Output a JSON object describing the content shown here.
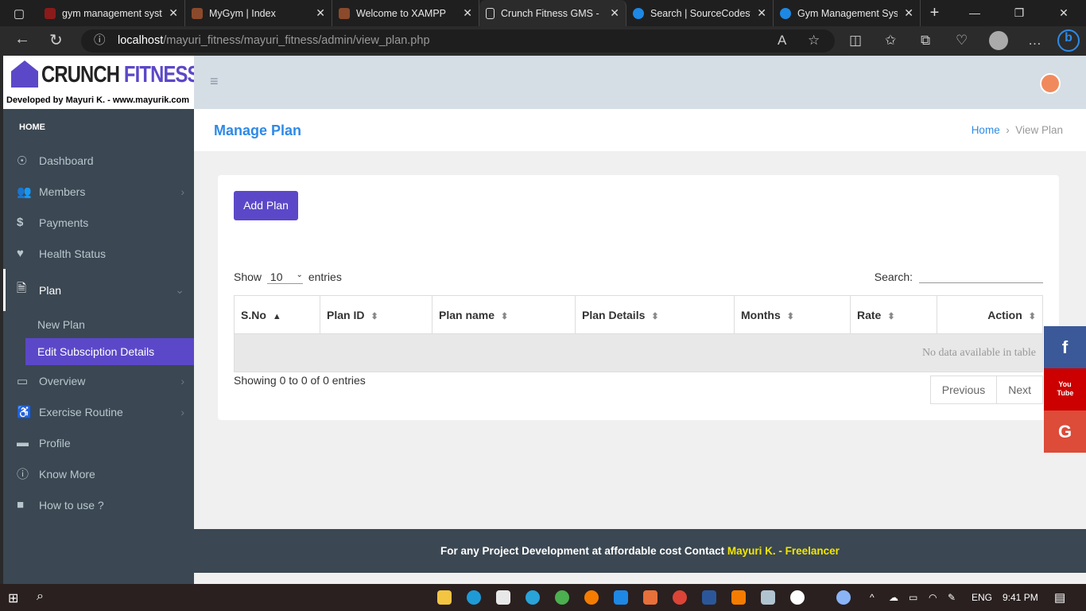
{
  "browser": {
    "tabs": [
      {
        "title": "gym management syst",
        "color": "#c4302b"
      },
      {
        "title": "MyGym | Index",
        "color": "#8b4a2b"
      },
      {
        "title": "Welcome to XAMPP",
        "color": "#8b4a2b"
      },
      {
        "title": "Crunch Fitness GMS - ",
        "color": "#ddd",
        "active": true
      },
      {
        "title": "Search | SourceCodest",
        "color": "#1e88e5"
      },
      {
        "title": "Gym Management Sys",
        "color": "#1e88e5"
      }
    ],
    "url_host": "localhost",
    "url_path": "/mayuri_fitness/mayuri_fitness/admin/view_plan.php"
  },
  "logo": {
    "brand_a": "CRUNCH",
    "brand_b": "FITNESS",
    "developer": "Developed by Mayuri K. - www.mayurik.com"
  },
  "sidebar": {
    "header": "HOME",
    "items": [
      {
        "label": "Dashboard",
        "icon": "☉"
      },
      {
        "label": "Members",
        "icon": "👥"
      },
      {
        "label": "Payments",
        "icon": "$"
      },
      {
        "label": "Health Status",
        "icon": "♥"
      },
      {
        "label": "Plan",
        "icon": "🗎"
      },
      {
        "label": "Overview",
        "icon": "▭"
      },
      {
        "label": "Exercise Routine",
        "icon": "♿"
      },
      {
        "label": "Profile",
        "icon": "▬"
      },
      {
        "label": "Know More",
        "icon": "ⓘ"
      },
      {
        "label": "How to use ?",
        "icon": "■"
      }
    ],
    "plan_sub": [
      "New Plan",
      "Edit Subsciption Details"
    ]
  },
  "page": {
    "title": "Manage Plan",
    "crumb_home": "Home",
    "crumb_current": "View Plan"
  },
  "table": {
    "add_button": "Add Plan",
    "show": "Show",
    "entries_value": "10",
    "entries": "entries",
    "search_label": "Search:",
    "columns": [
      "S.No",
      "Plan ID",
      "Plan name",
      "Plan Details",
      "Months",
      "Rate",
      "Action"
    ],
    "empty": "No data available in table",
    "info": "Showing 0 to 0 of 0 entries",
    "prev": "Previous",
    "next": "Next"
  },
  "social": {
    "facebook": "f",
    "youtube": "You Tube",
    "google": "G",
    "colors": {
      "facebook": "#3b5998",
      "youtube": "#cc0000",
      "google": "#dd4b39"
    }
  },
  "footer": {
    "text": "For any Project Development at affordable cost Contact ",
    "highlight": "Mayuri K. - Freelancer"
  },
  "taskbar": {
    "lang": "ENG",
    "time": "9:41 PM"
  }
}
